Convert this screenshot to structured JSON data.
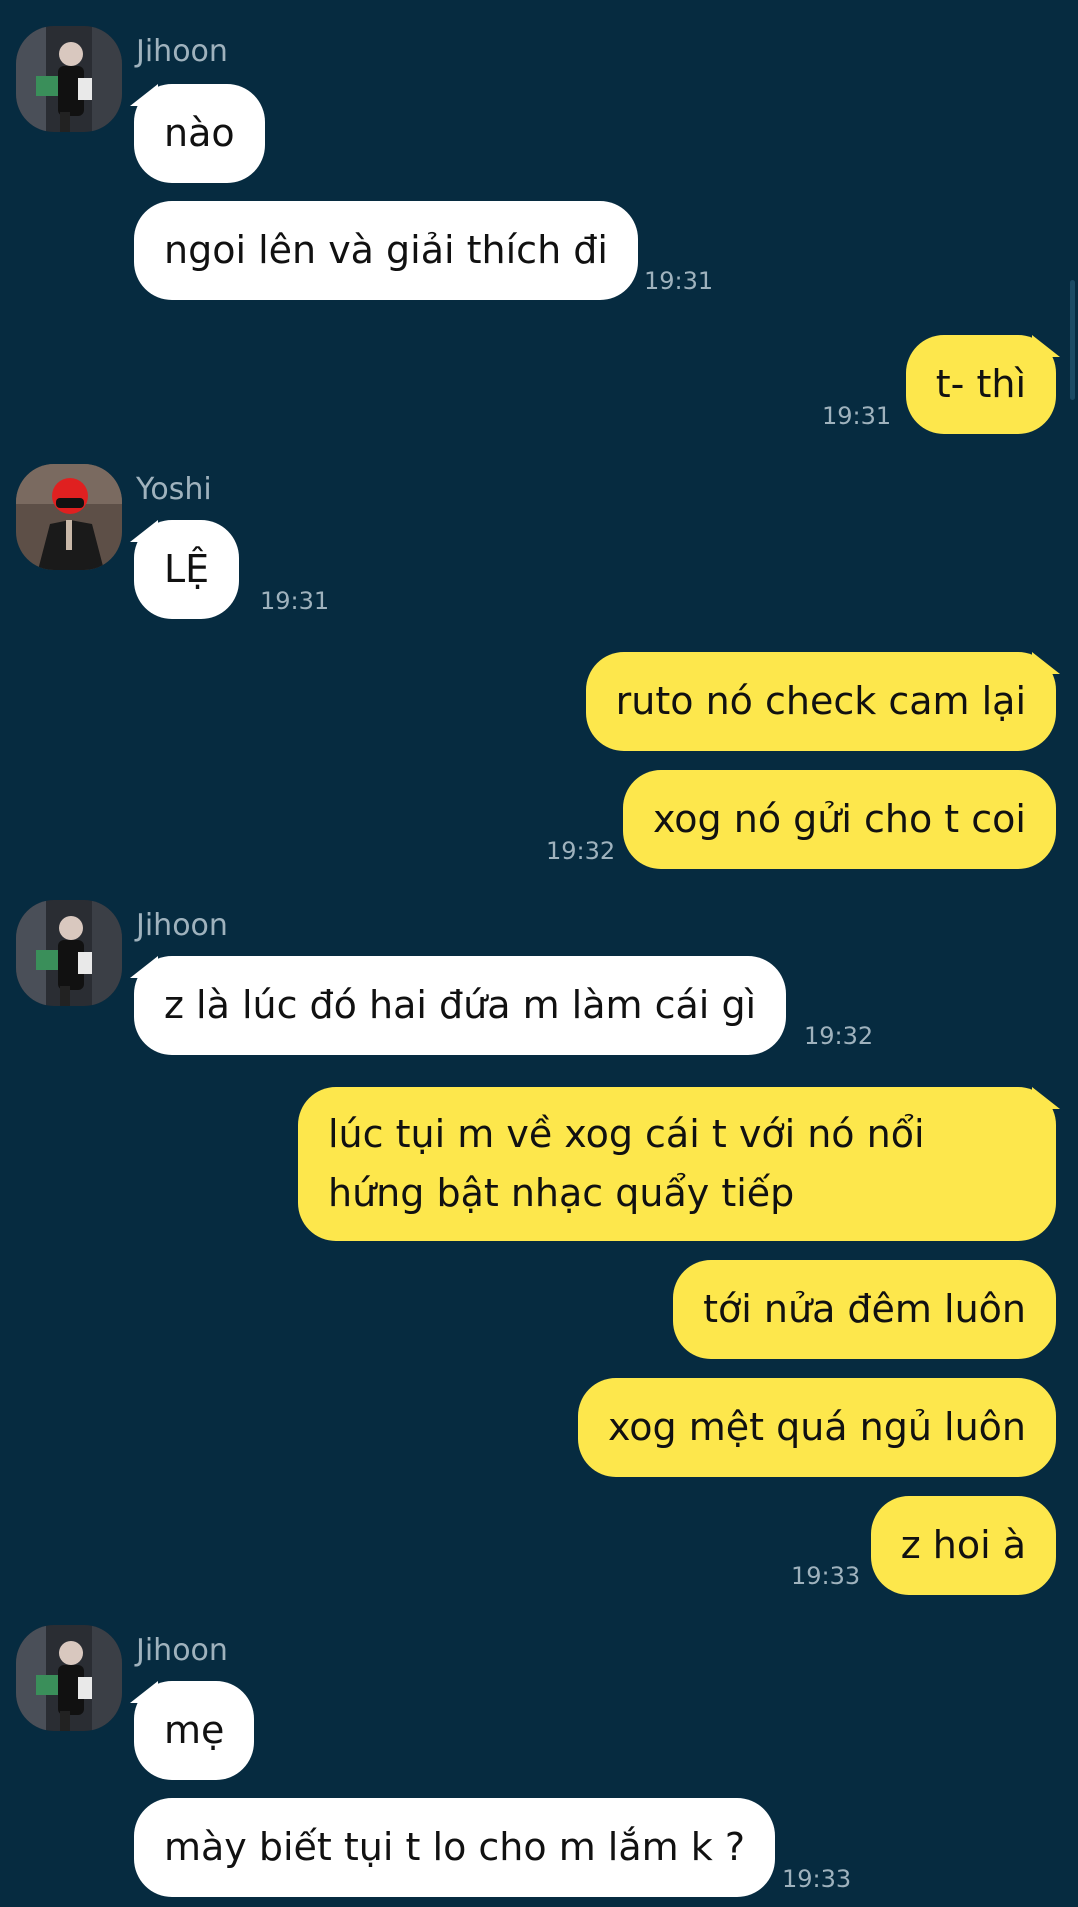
{
  "chat": {
    "groups": [
      {
        "sender": "Jihoon",
        "avatar_icon": "jihoon-avatar",
        "messages": [
          "nào",
          "ngoi lên và giải thích đi"
        ],
        "time": "19:31"
      },
      {
        "outgoing": true,
        "messages": [
          "t- thì"
        ],
        "time": "19:31"
      },
      {
        "sender": "Yoshi",
        "avatar_icon": "yoshi-avatar",
        "messages": [
          "LỆ"
        ],
        "time": "19:31"
      },
      {
        "outgoing": true,
        "messages": [
          "ruto nó check cam lại",
          "xog nó gửi cho t coi"
        ],
        "time": "19:32"
      },
      {
        "sender": "Jihoon",
        "avatar_icon": "jihoon-avatar",
        "messages": [
          "z là lúc đó hai đứa m làm cái gì"
        ],
        "time": "19:32"
      },
      {
        "outgoing": true,
        "messages": [
          "lúc tụi m về xog cái t với nó nổi hứng bật nhạc quẩy tiếp",
          "tới nửa đêm luôn",
          "xog mệt quá ngủ luôn",
          "z hoi à"
        ],
        "time": "19:33"
      },
      {
        "sender": "Jihoon",
        "avatar_icon": "jihoon-avatar",
        "messages": [
          "mẹ",
          "mày biết tụi t lo cho m lắm k ?"
        ],
        "time": "19:33"
      }
    ]
  },
  "colors": {
    "background": "#062b40",
    "incoming_bubble": "#ffffff",
    "outgoing_bubble": "#fde74c",
    "meta_text": "#9fb2bd"
  }
}
